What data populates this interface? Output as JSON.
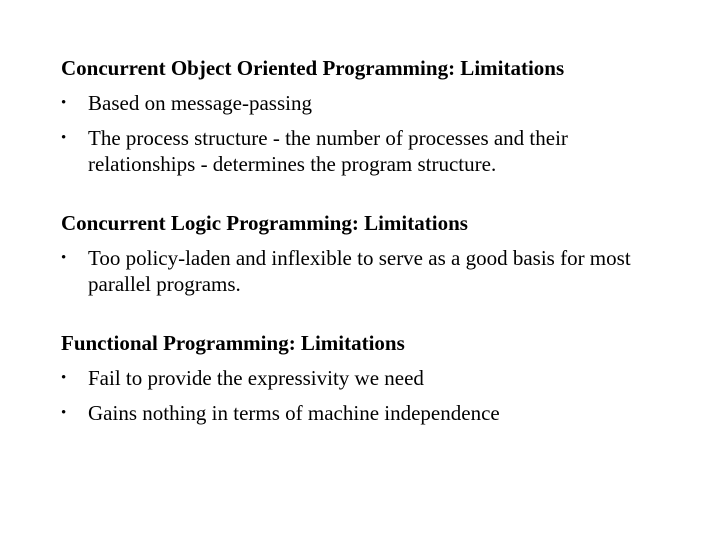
{
  "sections": [
    {
      "heading": "Concurrent Object Oriented Programming: Limitations",
      "bullets": [
        "Based on message-passing",
        "The process structure - the number of processes and their relationships - determines the program structure."
      ]
    },
    {
      "heading": "Concurrent Logic Programming: Limitations",
      "bullets": [
        "Too policy-laden and inflexible to serve as a good basis for most parallel programs."
      ]
    },
    {
      "heading": "Functional Programming: Limitations",
      "bullets": [
        "Fail to provide the expressivity we need",
        "Gains nothing in terms of machine independence"
      ]
    }
  ],
  "bullet_glyph": "•"
}
